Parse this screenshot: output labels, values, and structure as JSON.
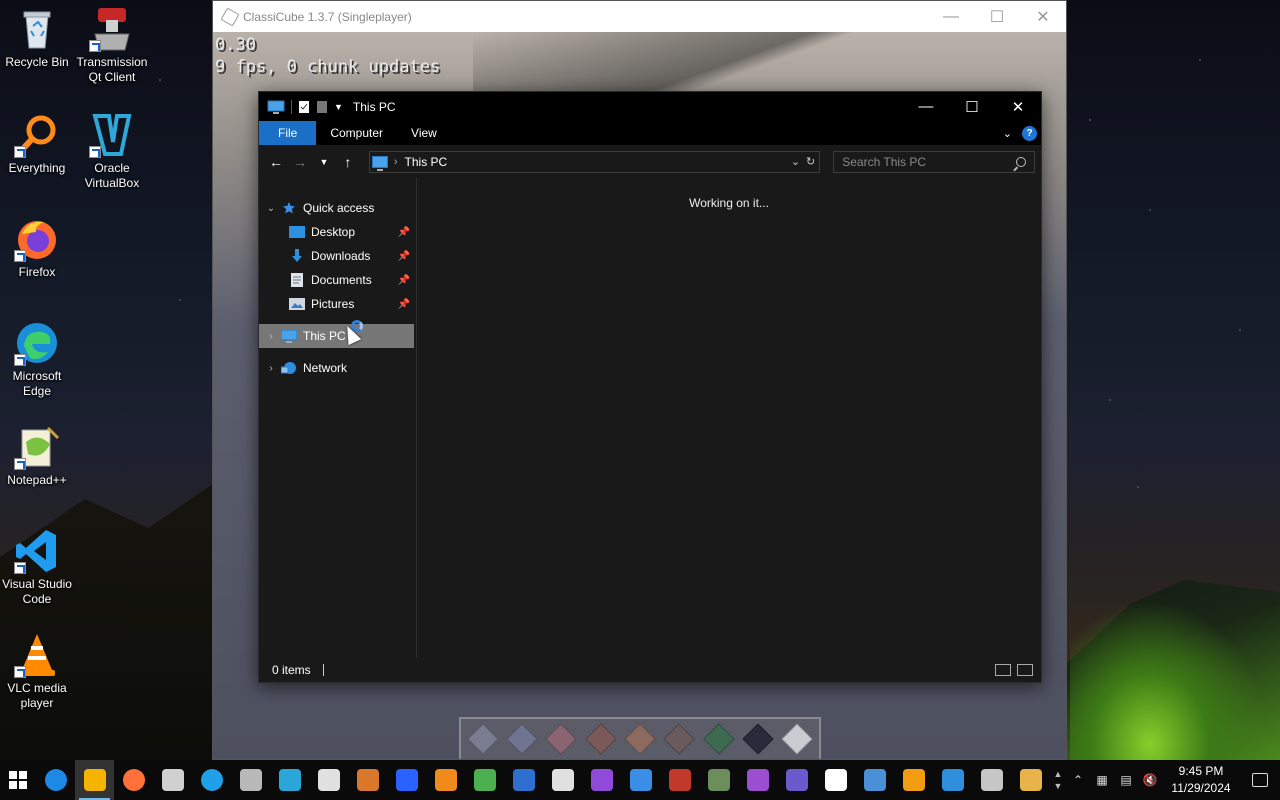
{
  "desktop": {
    "icons": [
      {
        "label": "Recycle Bin"
      },
      {
        "label": "Transmission Qt Client"
      },
      {
        "label": "Everything"
      },
      {
        "label": "Oracle VirtualBox"
      },
      {
        "label": "Firefox"
      },
      {
        "label": "Microsoft Edge"
      },
      {
        "label": "Notepad++"
      },
      {
        "label": "Visual Studio Code"
      },
      {
        "label": "VLC media player"
      }
    ]
  },
  "classicube": {
    "title": "ClassiCube 1.3.7 (Singleplayer)",
    "debug_line1": "0.30",
    "debug_line2": "9 fps, 0 chunk updates",
    "hotbar_colors": [
      "#7a7d92",
      "#6f7590",
      "#8a6470",
      "#7a5a58",
      "#8c6a60",
      "#6a5a5c",
      "#3e6a52",
      "#2a2a3a",
      "#c9cbd0"
    ]
  },
  "explorer": {
    "title": "This PC",
    "tabs": {
      "file": "File",
      "computer": "Computer",
      "view": "View"
    },
    "address": "This PC",
    "search_placeholder": "Search This PC",
    "nav": {
      "quick_access": "Quick access",
      "desktop": "Desktop",
      "downloads": "Downloads",
      "documents": "Documents",
      "pictures": "Pictures",
      "this_pc": "This PC",
      "network": "Network"
    },
    "content_status": "Working on it...",
    "status_items": "0 items"
  },
  "taskbar": {
    "time": "9:45 PM",
    "date": "11/29/2024",
    "pinned_colors": [
      "#1e88e5",
      "#f4b400",
      "#ff7139",
      "#d0d0d0",
      "#1fa0e8",
      "#b9b9b9",
      "#2aa7d8",
      "#e0e0e0",
      "#d9772b",
      "#2962ff",
      "#f08a1c",
      "#4caf50",
      "#2f6fd0",
      "#e0e0e0",
      "#8f4ad9",
      "#3a8ee6",
      "#c0392b",
      "#6c8e5a",
      "#9b4fd0",
      "#6a5acd",
      "#ffffff",
      "#4a90d9",
      "#f39c12",
      "#2f8fdc",
      "#c6c6c6",
      "#e8b44a"
    ],
    "accent": "#76b9ed"
  }
}
